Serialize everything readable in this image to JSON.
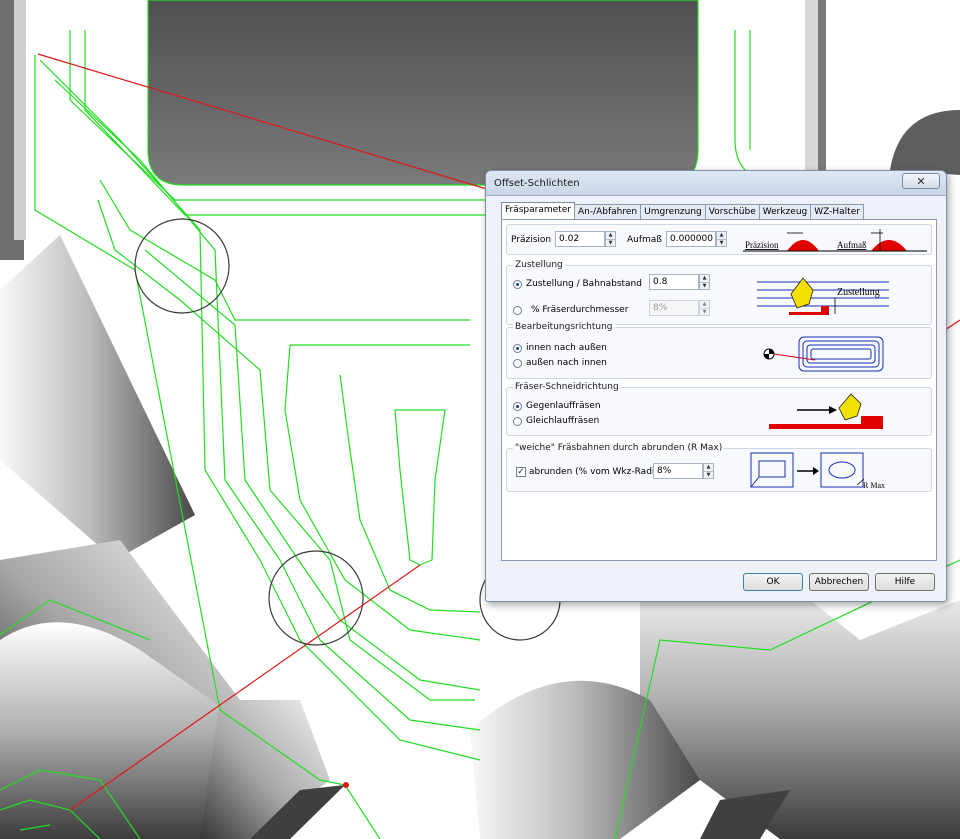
{
  "dialog": {
    "title": "Offset-Schlichten",
    "close_label": "✕",
    "tabs": [
      {
        "label": "Fräsparameter",
        "active": true
      },
      {
        "label": "An-/Abfahren",
        "active": false
      },
      {
        "label": "Umgrenzung",
        "active": false
      },
      {
        "label": "Vorschübe",
        "active": false
      },
      {
        "label": "Werkzeug",
        "active": false
      },
      {
        "label": "WZ-Halter",
        "active": false
      }
    ],
    "params": {
      "praezision_label": "Präzision",
      "praezision_value": "0.02",
      "aufmass_label": "Aufmaß",
      "aufmass_value": "0.000000",
      "img_praezision": "Präzision",
      "img_aufmass": "Aufmaß"
    },
    "zustellung": {
      "title": "Zustellung",
      "opt1_label": "Zustellung / Bahnabstand",
      "opt1_value": "0.8",
      "opt2_label": "% Fräserdurchmesser",
      "opt2_value": "8%",
      "img_label": "Zustellung",
      "selected": "opt1"
    },
    "bearbeitung": {
      "title": "Bearbeitungsrichtung",
      "opt1_label": "innen nach außen",
      "opt2_label": "außen nach innen",
      "selected": "opt1"
    },
    "schneid": {
      "title": "Fräser-Schneidrichtung",
      "opt1_label": "Gegenlauffräsen",
      "opt2_label": "Gleichlauffräsen",
      "selected": "opt1"
    },
    "weiche": {
      "title": "\"weiche\" Fräsbahnen durch abrunden (R Max)",
      "check_label": "abrunden (% vom Wkz-Radius)",
      "checked": true,
      "value": "8%",
      "img_label": "R Max"
    },
    "buttons": {
      "ok": "OK",
      "cancel": "Abbrechen",
      "help": "Hilfe"
    }
  },
  "colors": {
    "toolpath": "#22dd22",
    "link_line": "#e01818",
    "accent_red": "#e00000",
    "tool_yellow": "#f2e000",
    "guide_blue": "#1b2fb0"
  }
}
